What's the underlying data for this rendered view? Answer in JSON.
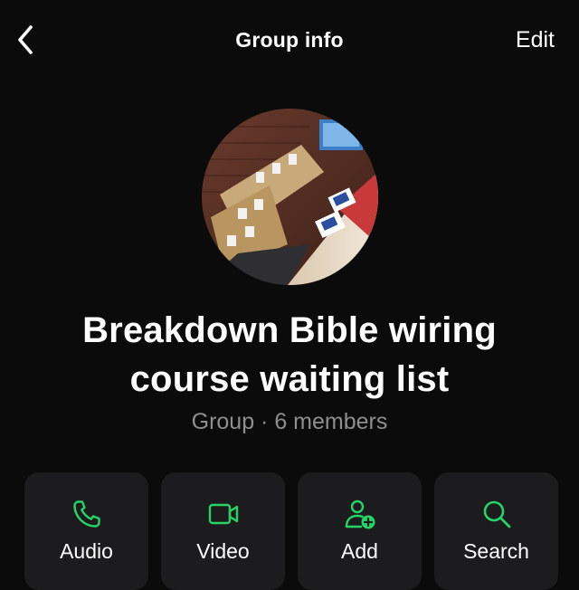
{
  "nav": {
    "title": "Group info",
    "edit_label": "Edit"
  },
  "group": {
    "name": "Breakdown Bible wiring course waiting list",
    "subtitle": "Group · 6 members"
  },
  "actions": [
    {
      "label": "Audio",
      "icon": "phone-icon"
    },
    {
      "label": "Video",
      "icon": "video-camera-icon"
    },
    {
      "label": "Add",
      "icon": "add-person-icon"
    },
    {
      "label": "Search",
      "icon": "search-icon"
    }
  ],
  "colors": {
    "background": "#0b0b0b",
    "card": "#1c1c1e",
    "accent": "#25d366",
    "muted_text": "#8e8e8e"
  }
}
